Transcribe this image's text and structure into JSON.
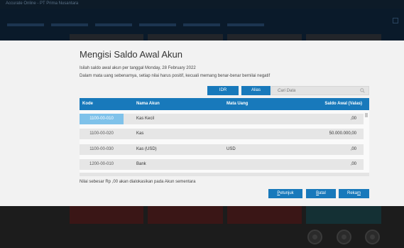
{
  "background": {
    "title_text": "Accurate Online - PT Prima Nusantara"
  },
  "dialog": {
    "title": "Mengisi Saldo Awal Akun",
    "desc_line1": "Isilah saldo awal akun per tanggal Monday, 28 February 2022",
    "desc_line2": "Dalam mata uang sebenarnya, setiap nilai harus positif, kecuali memang benar-benar bernilai negatif",
    "currency_button": "IDR",
    "alias_button": "Alias",
    "search_placeholder": "Cari Data",
    "columns": {
      "kode": "Kode",
      "nama": "Nama Akun",
      "mata_uang": "Mata Uang",
      "saldo": "Saldo Awal (Valas)"
    },
    "rows": [
      {
        "kode": "1100-00-010",
        "nama": "Kas Kecil",
        "mata_uang": "",
        "saldo": ",00",
        "selected": true
      },
      {
        "kode": "1100-00-020",
        "nama": "Kas",
        "mata_uang": "",
        "saldo": "50.000.000,00",
        "selected": false
      },
      {
        "kode": "1100-00-030",
        "nama": "Kas (USD)",
        "mata_uang": "USD",
        "saldo": ",00",
        "selected": false
      },
      {
        "kode": "1200-00-010",
        "nama": "Bank",
        "mata_uang": "",
        "saldo": ",00",
        "selected": false
      }
    ],
    "note": "Nilai sebesar Rp ,00 akan dialokasikan pada Akun sementara",
    "buttons": {
      "petunjuk": {
        "first": "P",
        "rest": "etunjuk"
      },
      "batal": {
        "first": "B",
        "rest": "atal"
      },
      "rekam": {
        "start": "Reka",
        "underline": "m",
        "end": ""
      }
    }
  },
  "colors": {
    "accent": "#1879bb",
    "selected_cell": "#7fc2ea",
    "row_bg": "#e6e6e6"
  },
  "icons": {
    "search": "search-icon"
  }
}
